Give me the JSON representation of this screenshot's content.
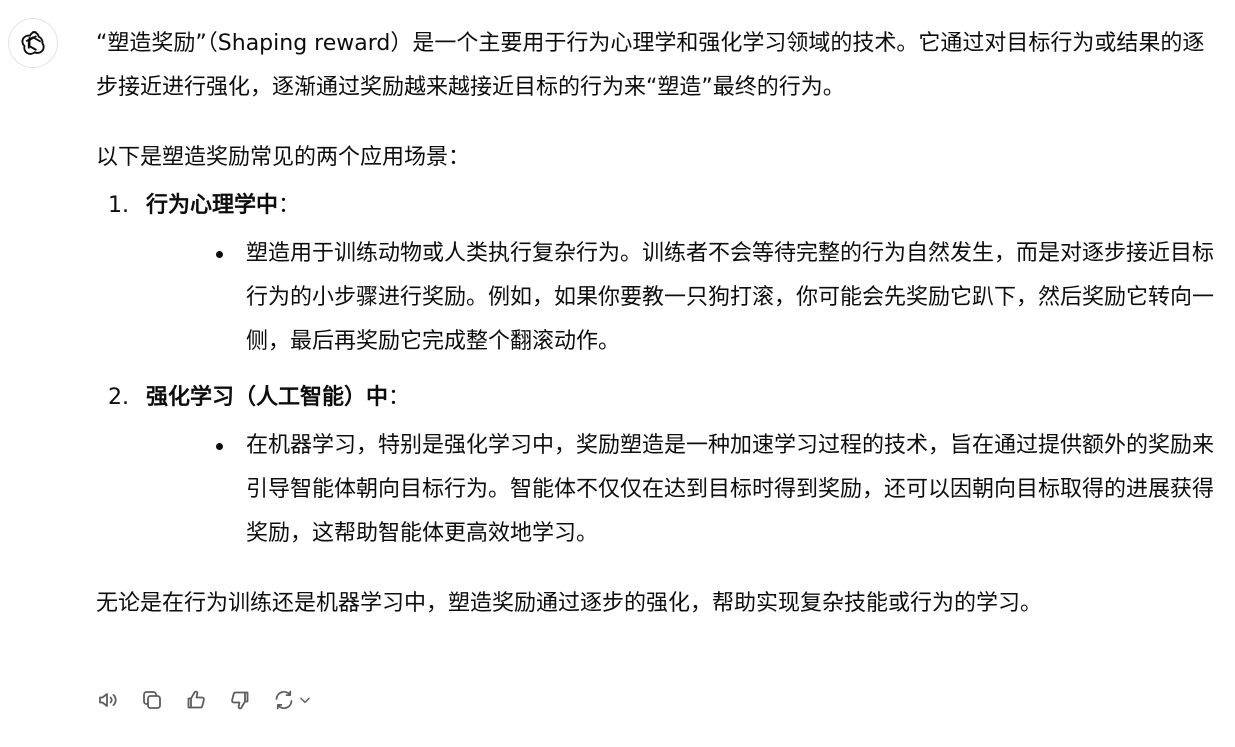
{
  "assistant": {
    "avatar_icon": "openai-logo-icon"
  },
  "message": {
    "intro": "“塑造奖励”（Shaping reward）是一个主要用于行为心理学和强化学习领域的技术。它通过对目标行为或结果的逐步接近进行强化，逐渐通过奖励越来越接近目标的行为来“塑造”最终的行为。",
    "lead": "以下是塑造奖励常见的两个应用场景：",
    "items": [
      {
        "number": "1.",
        "title": "行为心理学中",
        "colon": "：",
        "bullet": "塑造用于训练动物或人类执行复杂行为。训练者不会等待完整的行为自然发生，而是对逐步接近目标行为的小步骤进行奖励。例如，如果你要教一只狗打滚，你可能会先奖励它趴下，然后奖励它转向一侧，最后再奖励它完成整个翻滚动作。"
      },
      {
        "number": "2.",
        "title": "强化学习（人工智能）中",
        "colon": "：",
        "bullet": "在机器学习，特别是强化学习中，奖励塑造是一种加速学习过程的技术，旨在通过提供额外的奖励来引导智能体朝向目标行为。智能体不仅仅在达到目标时得到奖励，还可以因朝向目标取得的进展获得奖励，这帮助智能体更高效地学习。"
      }
    ],
    "outro": "无论是在行为训练还是机器学习中，塑造奖励通过逐步的强化，帮助实现复杂技能或行为的学习。"
  },
  "actions": [
    {
      "icon": "speaker-icon"
    },
    {
      "icon": "copy-icon"
    },
    {
      "icon": "thumbs-up-icon"
    },
    {
      "icon": "thumbs-down-icon"
    },
    {
      "icon": "regenerate-icon"
    }
  ],
  "colors": {
    "text": "#0d0d0d",
    "icon": "#5d5d5d",
    "avatar_border": "#e3e3e3"
  }
}
